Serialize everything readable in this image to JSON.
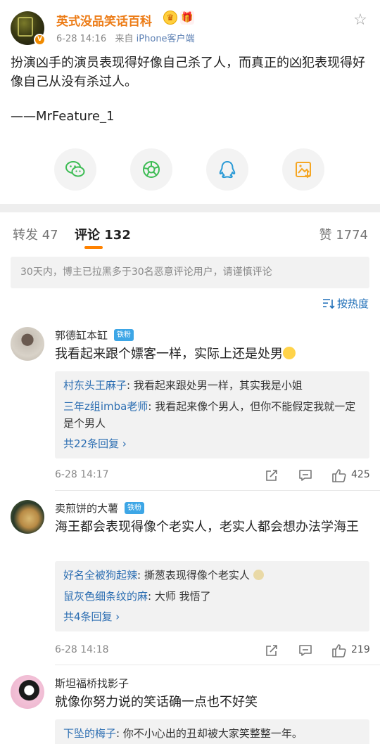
{
  "post": {
    "author": "英式没品笑话百科",
    "time": "6-28 14:16",
    "source_prefix": "来自",
    "source": "iPhone客户端",
    "text": "扮演凶手的演员表现得好像自己杀了人，而真正的凶犯表现得好像自己从没有杀过人。",
    "signature": "——MrFeature_1",
    "v_badge": "V"
  },
  "share": {
    "icons": [
      "wechat-icon",
      "moments-icon",
      "qq-icon",
      "save-image-icon"
    ],
    "colors": {
      "wechat": "#3dbc54",
      "moments": "#3dbc54",
      "qq": "#2a9ad6",
      "save": "#f5a623"
    }
  },
  "tabs": {
    "repost": "转发 47",
    "comments": "评论 132",
    "likes": "赞 1774",
    "accent": "#ff8200"
  },
  "notice": "30天内，博主已拉黑多于30名恶意评论用户，请谨慎评论",
  "sort_label": "按热度",
  "comments": [
    {
      "name": "郭德缸本缸",
      "badge": "铁粉",
      "text": "我看起来跟个嫖客一样，实际上还是处男",
      "replies": [
        {
          "name": "村东头王麻子",
          "text": "我看起来跟处男一样，其实我是小姐"
        },
        {
          "name": "三年z组imba老师",
          "text": "我看起来像个男人，但你不能假定我就一定是个男人"
        }
      ],
      "more": "共22条回复 ›",
      "time": "6-28 14:17",
      "likes": "425"
    },
    {
      "name": "卖煎饼的大薯",
      "badge": "铁粉",
      "text": "海王都会表现得像个老实人，老实人都会想办法学海王",
      "replies": [
        {
          "name": "好名全被狗起辣",
          "text": "撕葱表现得像个老实人"
        },
        {
          "name": "鼠灰色细条纹的麻",
          "text": "大师 我悟了"
        }
      ],
      "more": "共4条回复 ›",
      "time": "6-28 14:18",
      "likes": "219"
    },
    {
      "name": "斯坦福桥找影子",
      "text": "就像你努力说的笑话确一点也不好笑",
      "replies": [
        {
          "name": "下坠的梅子",
          "text": "你不小心出的丑却被大家笑整整一年。"
        }
      ]
    }
  ]
}
